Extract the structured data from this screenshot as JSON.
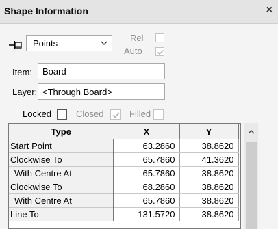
{
  "window": {
    "title": "Shape Information",
    "close_label": "×"
  },
  "toolbar": {
    "pin_icon": "pin-icon",
    "mode_select": {
      "value": "Points"
    },
    "rel_label": "Rel",
    "rel_checked": false,
    "auto_label": "Auto",
    "auto_checked": true
  },
  "fields": {
    "item_label": "Item:",
    "item_value": "Board",
    "layer_label": "Layer:",
    "layer_value": "<Through Board>"
  },
  "options": {
    "locked_label": "Locked",
    "locked_checked": false,
    "closed_label": "Closed",
    "closed_checked": true,
    "filled_label": "Filled",
    "filled_checked": false
  },
  "table": {
    "columns": [
      "Type",
      "X",
      "Y"
    ],
    "rows": [
      {
        "type": "Start Point",
        "x": "63.2860",
        "y": "38.8620"
      },
      {
        "type": "Clockwise To",
        "x": "65.7860",
        "y": "41.3620"
      },
      {
        "type": " With Centre At",
        "x": "65.7860",
        "y": "38.8620"
      },
      {
        "type": "Clockwise To",
        "x": "68.2860",
        "y": "38.8620"
      },
      {
        "type": " With Centre At",
        "x": "65.7860",
        "y": "38.8620"
      },
      {
        "type": "Line To",
        "x": "131.5720",
        "y": "38.8620"
      }
    ]
  },
  "colors": {
    "titlebar": "#e4e4e4",
    "panel": "#f4f4f4",
    "disabled_text": "#8d8d8d"
  }
}
